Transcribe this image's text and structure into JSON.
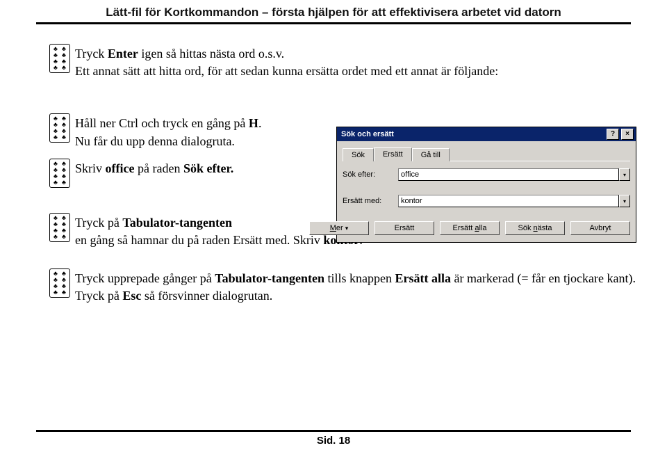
{
  "doc": {
    "title": "Lätt-fil för Kortkommandon – första hjälpen för att effektivisera arbetet vid datorn",
    "footer": "Sid. 18"
  },
  "bullets": {
    "p1_a": "Tryck ",
    "p1_b": "Enter",
    "p1_c": " igen så hittas nästa ord o.s.v.",
    "p1_d": "Ett annat sätt att hitta ord, för att sedan kunna ersätta ordet med ett annat är följande:",
    "p2_a": "Håll ner Ctrl och tryck en gång på ",
    "p2_b": "H",
    "p2_c": ".",
    "p2_d": "Nu får du upp denna dialogruta.",
    "p3_a": "Skriv ",
    "p3_b": "office",
    "p3_c": " på raden ",
    "p3_d": "Sök efter.",
    "p4_a": "Tryck på ",
    "p4_b": "Tabulator-tangenten",
    "p4_c": "en gång så hamnar du på raden Ersätt med. Skriv ",
    "p4_d": "kontor",
    "p4_e": ".",
    "p5_a": "Tryck upprepade gånger på ",
    "p5_b": "Tabulator-tangenten",
    "p5_c": " tills knappen ",
    "p5_d": "Ersätt alla",
    "p5_e": " är markerad (= får en tjockare kant). Tryck på ",
    "p5_f": "Esc",
    "p5_g": " så försvinner dialogrutan."
  },
  "dialog": {
    "title": "Sök och ersätt",
    "tabs": {
      "t1": "Sök",
      "t2": "Ersätt",
      "t3": "Gå till"
    },
    "labels": {
      "find": "Sök efter:",
      "replace": "Ersätt med:"
    },
    "values": {
      "find": "office",
      "replace": "kontor"
    },
    "buttons": {
      "more": "Mer",
      "replace": "Ersätt",
      "replace_all": "Ersätt alla",
      "find_next": "Sök nästa",
      "cancel": "Avbryt"
    }
  }
}
